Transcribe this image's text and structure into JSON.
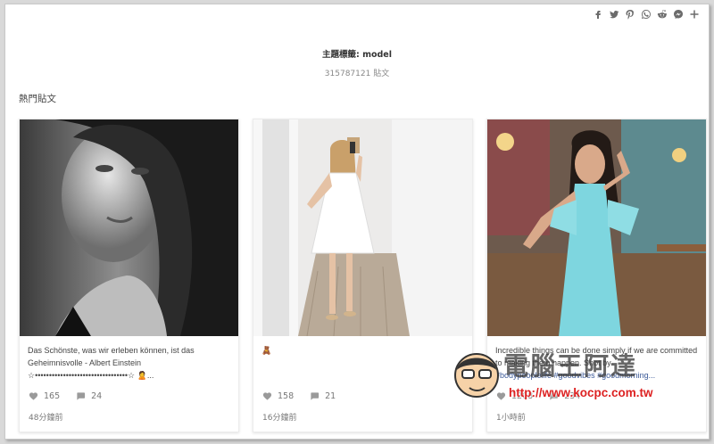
{
  "share_icons": [
    "facebook-icon",
    "twitter-icon",
    "pinterest-icon",
    "whatsapp-icon",
    "reddit-icon",
    "messenger-icon",
    "plus-icon"
  ],
  "header": {
    "title": "主題標籤: model",
    "count": "315787121 貼文"
  },
  "section_title": "熱門貼文",
  "posts": [
    {
      "caption": "Das Schönste, was wir erleben können, ist das Geheimnisvolle - Albert Einstein",
      "caption_extra": "☆•••••••••••••••••••••••••••••••••☆ 🙎...",
      "likes": "165",
      "comments": "24",
      "time": "48分鐘前"
    },
    {
      "caption": "🧸",
      "caption_extra": "",
      "likes": "158",
      "comments": "21",
      "time": "16分鐘前"
    },
    {
      "caption": "Incredible things can be done simply if we are committed to making them happen. Shot by",
      "caption_extra": "#bodypeoplelife #goodvibes #goodmorning...",
      "likes": "1208",
      "comments": "234",
      "time": "1小時前"
    }
  ],
  "watermark": {
    "text": "電腦王阿達",
    "url": "http://www.kocpc.com.tw"
  },
  "colors": {
    "accent_link": "#3b5998",
    "watermark_url": "#dd2222"
  }
}
